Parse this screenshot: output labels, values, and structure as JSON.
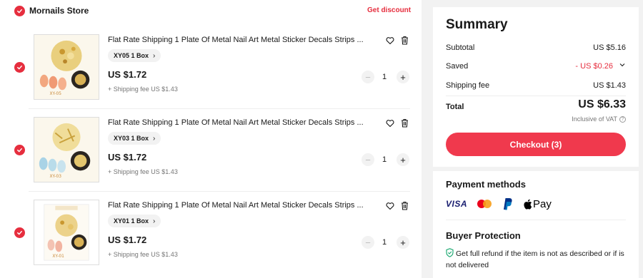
{
  "store": {
    "name": "Mornails Store",
    "discount_link": "Get discount"
  },
  "items": [
    {
      "title": "Flat Rate Shipping 1 Plate Of Metal Nail Art Metal Sticker Decals Strips ...",
      "variant": "XY05 1 Box",
      "price": "US $1.72",
      "shipping": "+ Shipping fee US $1.43",
      "quantity": "1",
      "thumb_label": "XY-05"
    },
    {
      "title": "Flat Rate Shipping 1 Plate Of Metal Nail Art Metal Sticker Decals Strips ...",
      "variant": "XY03 1 Box",
      "price": "US $1.72",
      "shipping": "+ Shipping fee US $1.43",
      "quantity": "1",
      "thumb_label": "XY-03"
    },
    {
      "title": "Flat Rate Shipping 1 Plate Of Metal Nail Art Metal Sticker Decals Strips ...",
      "variant": "XY01 1 Box",
      "price": "US $1.72",
      "shipping": "+ Shipping fee US $1.43",
      "quantity": "1",
      "thumb_label": "XY-01"
    }
  ],
  "icons": {
    "select": "checkmark-icon",
    "wishlist": "heart-icon",
    "delete": "trash-icon",
    "minus": "minus-icon",
    "plus": "plus-icon"
  },
  "summary": {
    "title": "Summary",
    "subtotal_label": "Subtotal",
    "subtotal_value": "US $5.16",
    "saved_label": "Saved",
    "saved_value": "- US $0.26",
    "shipping_label": "Shipping fee",
    "shipping_value": "US $1.43",
    "total_label": "Total",
    "total_value": "US $6.33",
    "vat_note": "Inclusive of VAT",
    "checkout_label": "Checkout (3)"
  },
  "payment": {
    "title": "Payment methods",
    "methods": [
      "VISA",
      "Mastercard",
      "PayPal",
      "Pay"
    ]
  },
  "protection": {
    "title": "Buyer Protection",
    "text": "Get full refund if the item is not as described or if is not delivered"
  },
  "colors": {
    "accent": "#e62e3e",
    "checkout": "#f0394d",
    "muted": "#757575"
  }
}
